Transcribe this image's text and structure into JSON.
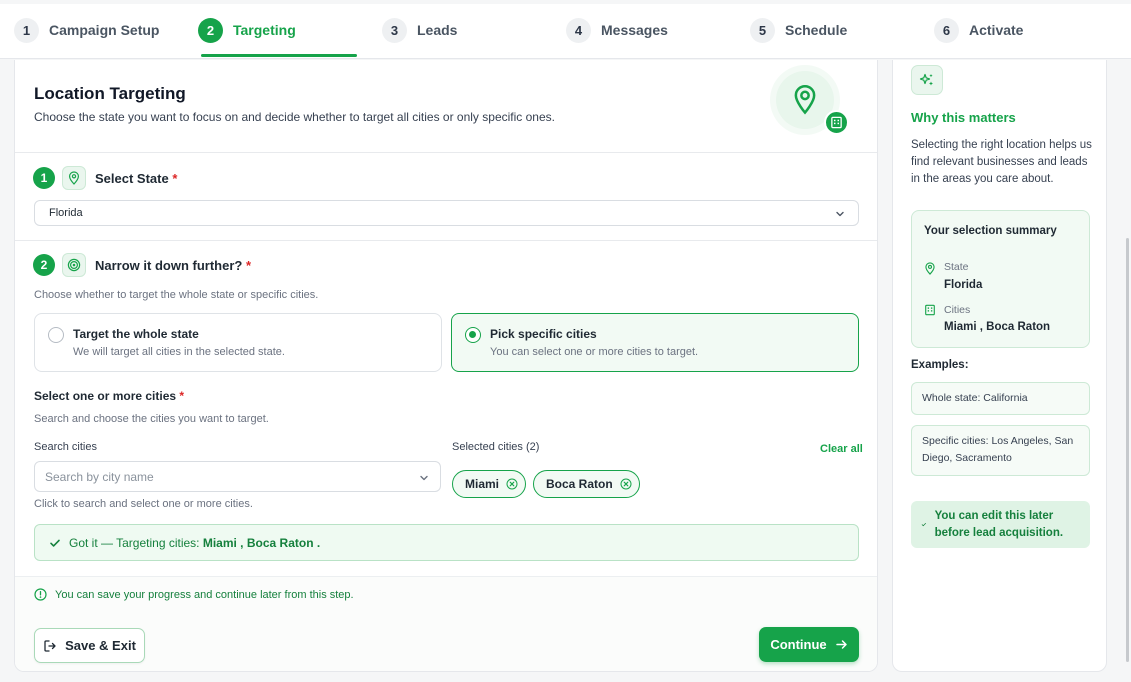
{
  "stepper": [
    {
      "num": "1",
      "label": "Campaign Setup"
    },
    {
      "num": "2",
      "label": "Targeting"
    },
    {
      "num": "3",
      "label": "Leads"
    },
    {
      "num": "4",
      "label": "Messages"
    },
    {
      "num": "5",
      "label": "Schedule"
    },
    {
      "num": "6",
      "label": "Activate"
    }
  ],
  "active_step": 2,
  "header": {
    "title": "Location Targeting",
    "subtitle": "Choose the state you want to focus on and decide whether to target all cities or only specific ones."
  },
  "state_section": {
    "num": "1",
    "title": "Select State",
    "required": "*",
    "selected_state": "Florida"
  },
  "narrow_section": {
    "num": "2",
    "title": "Narrow it down further?",
    "required": "*",
    "hint": "Choose whether to target the whole state or specific cities.",
    "options": [
      {
        "title": "Target the whole state",
        "desc": "We will target all cities in the selected state.",
        "selected": false
      },
      {
        "title": "Pick specific cities",
        "desc": "You can select one or more cities to target.",
        "selected": true
      }
    ]
  },
  "cities": {
    "title": "Select one or more cities",
    "required": "*",
    "subtitle": "Search and choose the cities you want to target.",
    "search_label": "Search cities",
    "search_placeholder": "Search by city name",
    "search_hint": "Click to search and select one or more cities.",
    "selected_label": "Selected cities (2)",
    "clear_all": "Clear all",
    "selected": [
      "Miami",
      "Boca Raton"
    ]
  },
  "success": {
    "prefix": "Got it — Targeting cities:",
    "cities": "Miami , Boca Raton",
    "suffix": "."
  },
  "footer": {
    "note": "You can save your progress and continue later from this step.",
    "save_label": "Save & Exit",
    "continue_label": "Continue"
  },
  "sidebar": {
    "title": "Why this matters",
    "text": "Selecting the right location helps us find relevant businesses and leads in the areas you care about.",
    "summary": {
      "title": "Your selection summary",
      "state_key": "State",
      "state_val": "Florida",
      "cities_key": "Cities",
      "cities_val": "Miami , Boca Raton"
    },
    "examples_label": "Examples:",
    "examples": [
      "Whole state: California",
      "Specific cities: Los Angeles, San Diego, Sacramento"
    ],
    "edit_note": "You can edit this later before lead acquisition."
  },
  "colors": {
    "accent": "#16a34a",
    "accent_light": "#f2faf4",
    "required": "#dc2626"
  }
}
